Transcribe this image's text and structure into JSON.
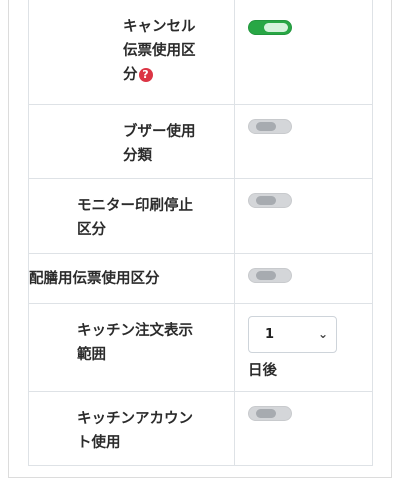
{
  "rows": [
    {
      "label_lines": [
        "キャンセル",
        "伝票使用区",
        "分"
      ],
      "help": "?",
      "toggle": "on"
    },
    {
      "label_lines": [
        "ブザー使用",
        "分類"
      ],
      "toggle": "off"
    },
    {
      "label_lines": [
        "モニター印刷停止",
        "区分"
      ],
      "toggle": "off"
    },
    {
      "label_lines": [
        "配膳用伝票使用区分"
      ],
      "toggle": "off"
    },
    {
      "label_lines": [
        "キッチン注文表示",
        "範囲"
      ],
      "select_value": "1",
      "unit": "日後"
    },
    {
      "label_lines": [
        "キッチンアカウン",
        "ト使用"
      ],
      "toggle": "off"
    }
  ],
  "icons": {
    "help": "question-circle-icon",
    "select_arrow": "chevron-down-icon"
  },
  "colors": {
    "toggle_on": "#28a745",
    "toggle_off": "#d4d6d9",
    "help": "#dc3545"
  }
}
